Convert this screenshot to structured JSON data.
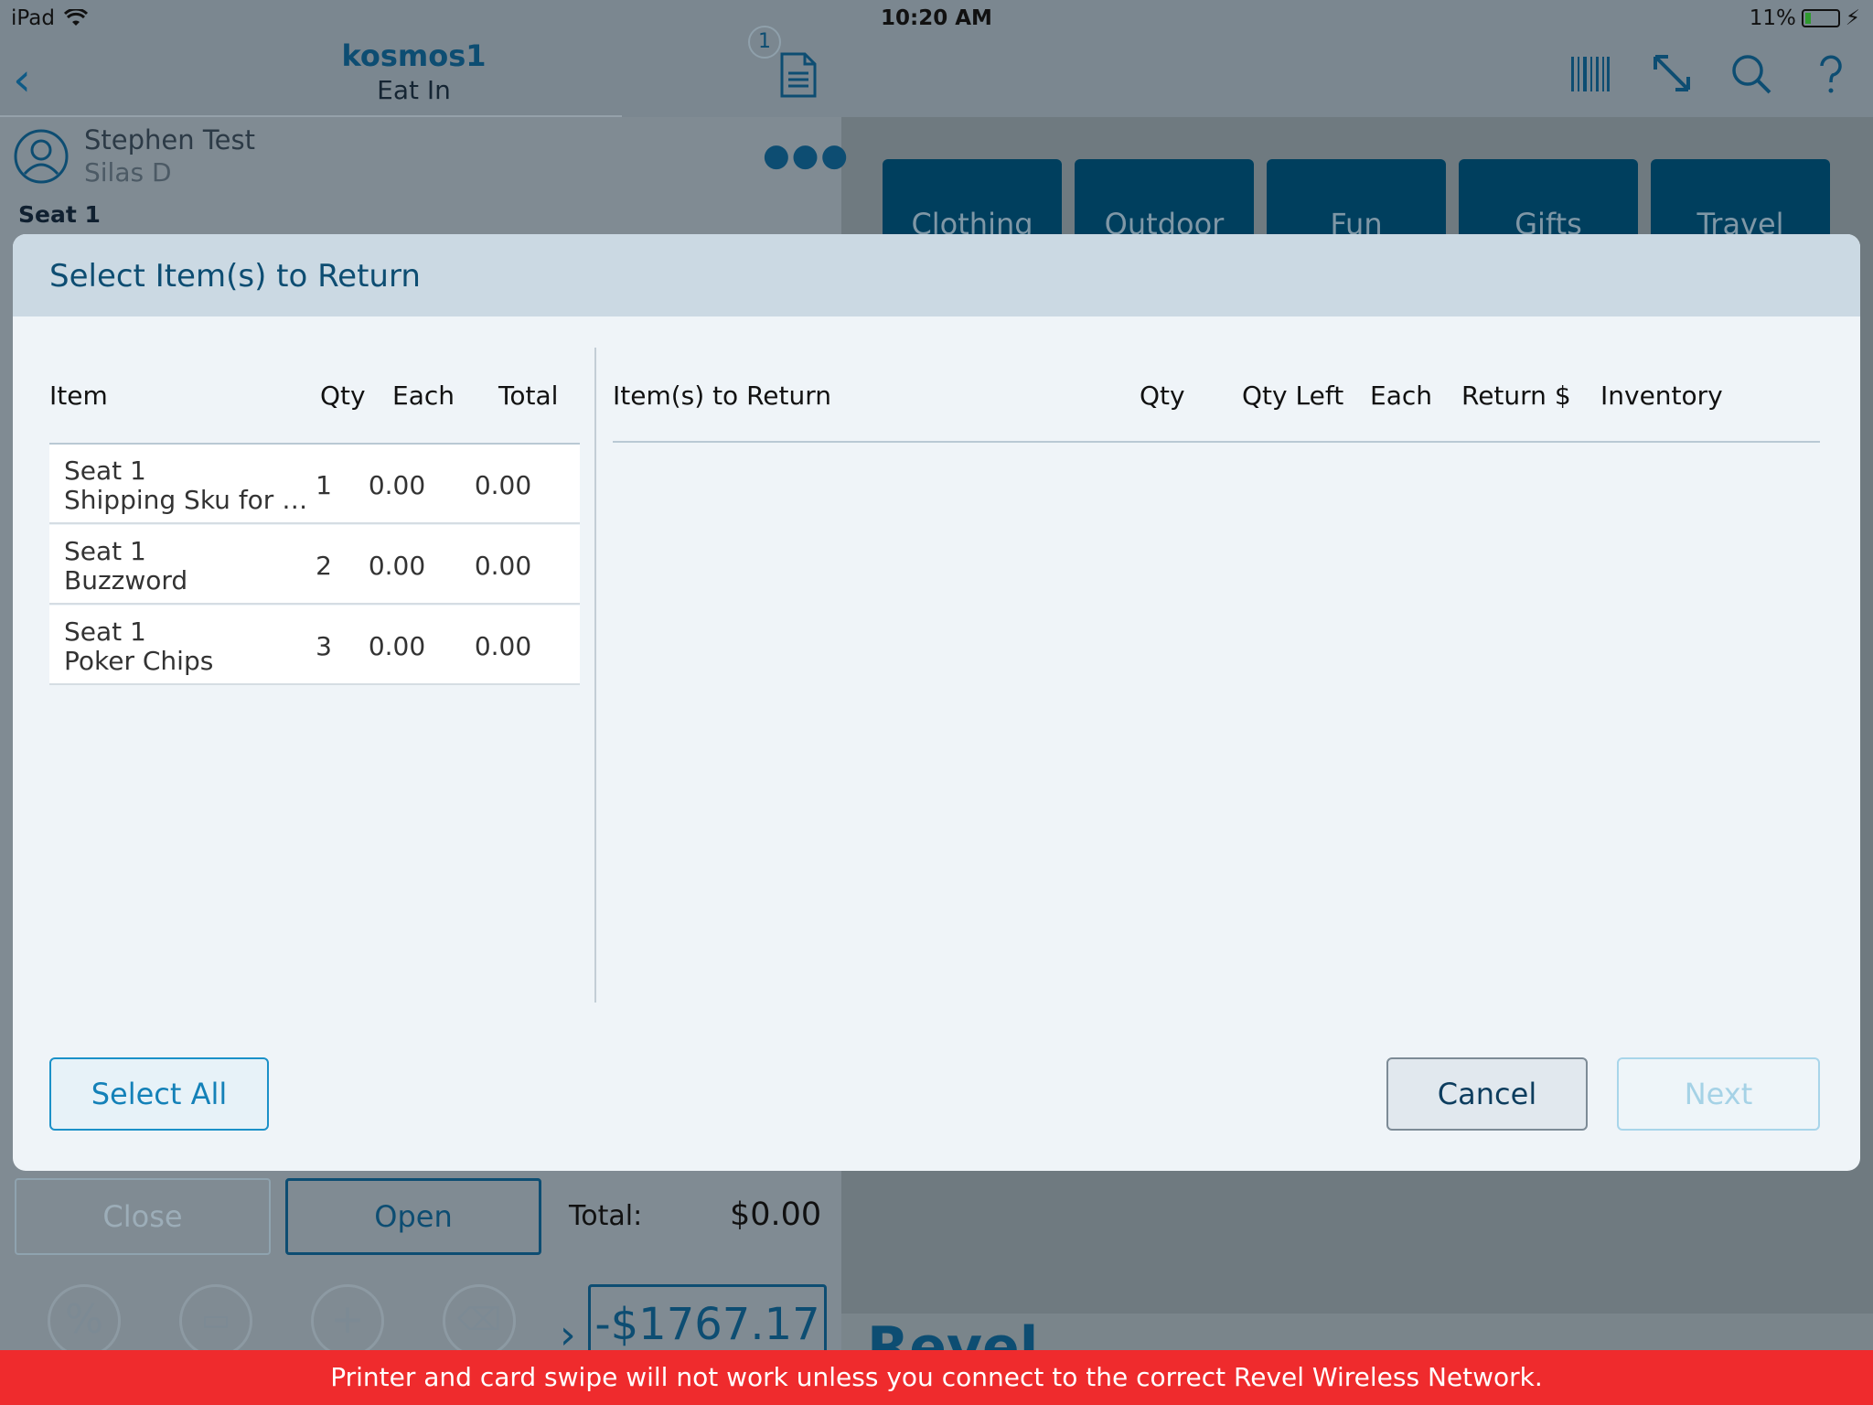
{
  "status_bar": {
    "device": "iPad",
    "time": "10:20 AM",
    "battery": "11%"
  },
  "order": {
    "title": "kosmos1",
    "subtitle": "Eat In",
    "receipt_count": "1"
  },
  "customer": {
    "name": "Stephen Test",
    "server": "Silas D",
    "seat": "Seat 1"
  },
  "categories": [
    "Clothing",
    "Outdoor",
    "Fun",
    "Gifts",
    "Travel"
  ],
  "bottom": {
    "close_label": "Close",
    "open_label": "Open",
    "total_label": "Total:",
    "total_value": "$0.00",
    "balance": "-$1767.17",
    "brand": "Revel"
  },
  "modal": {
    "title": "Select Item(s) to Return",
    "left_columns": {
      "item": "Item",
      "qty": "Qty",
      "each": "Each",
      "total": "Total"
    },
    "right_columns": {
      "items": "Item(s) to Return",
      "qty": "Qty",
      "qty_left": "Qty Left",
      "each": "Each",
      "return": "Return $",
      "inventory": "Inventory"
    },
    "items": [
      {
        "seat": "Seat 1",
        "name": "Shipping Sku for e...",
        "qty": "1",
        "each": "0.00",
        "total": "0.00"
      },
      {
        "seat": "Seat 1",
        "name": "Buzzword",
        "qty": "2",
        "each": "0.00",
        "total": "0.00"
      },
      {
        "seat": "Seat 1",
        "name": "Poker Chips",
        "qty": "3",
        "each": "0.00",
        "total": "0.00"
      }
    ],
    "select_all_label": "Select All",
    "cancel_label": "Cancel",
    "next_label": "Next"
  },
  "warning": "Printer and card swipe will not work unless you connect to the correct Revel Wireless Network.",
  "colors": {
    "accent": "#0d4d72",
    "link": "#1481b8",
    "warning": "#ef2b2d",
    "tile": "#003f5e"
  }
}
